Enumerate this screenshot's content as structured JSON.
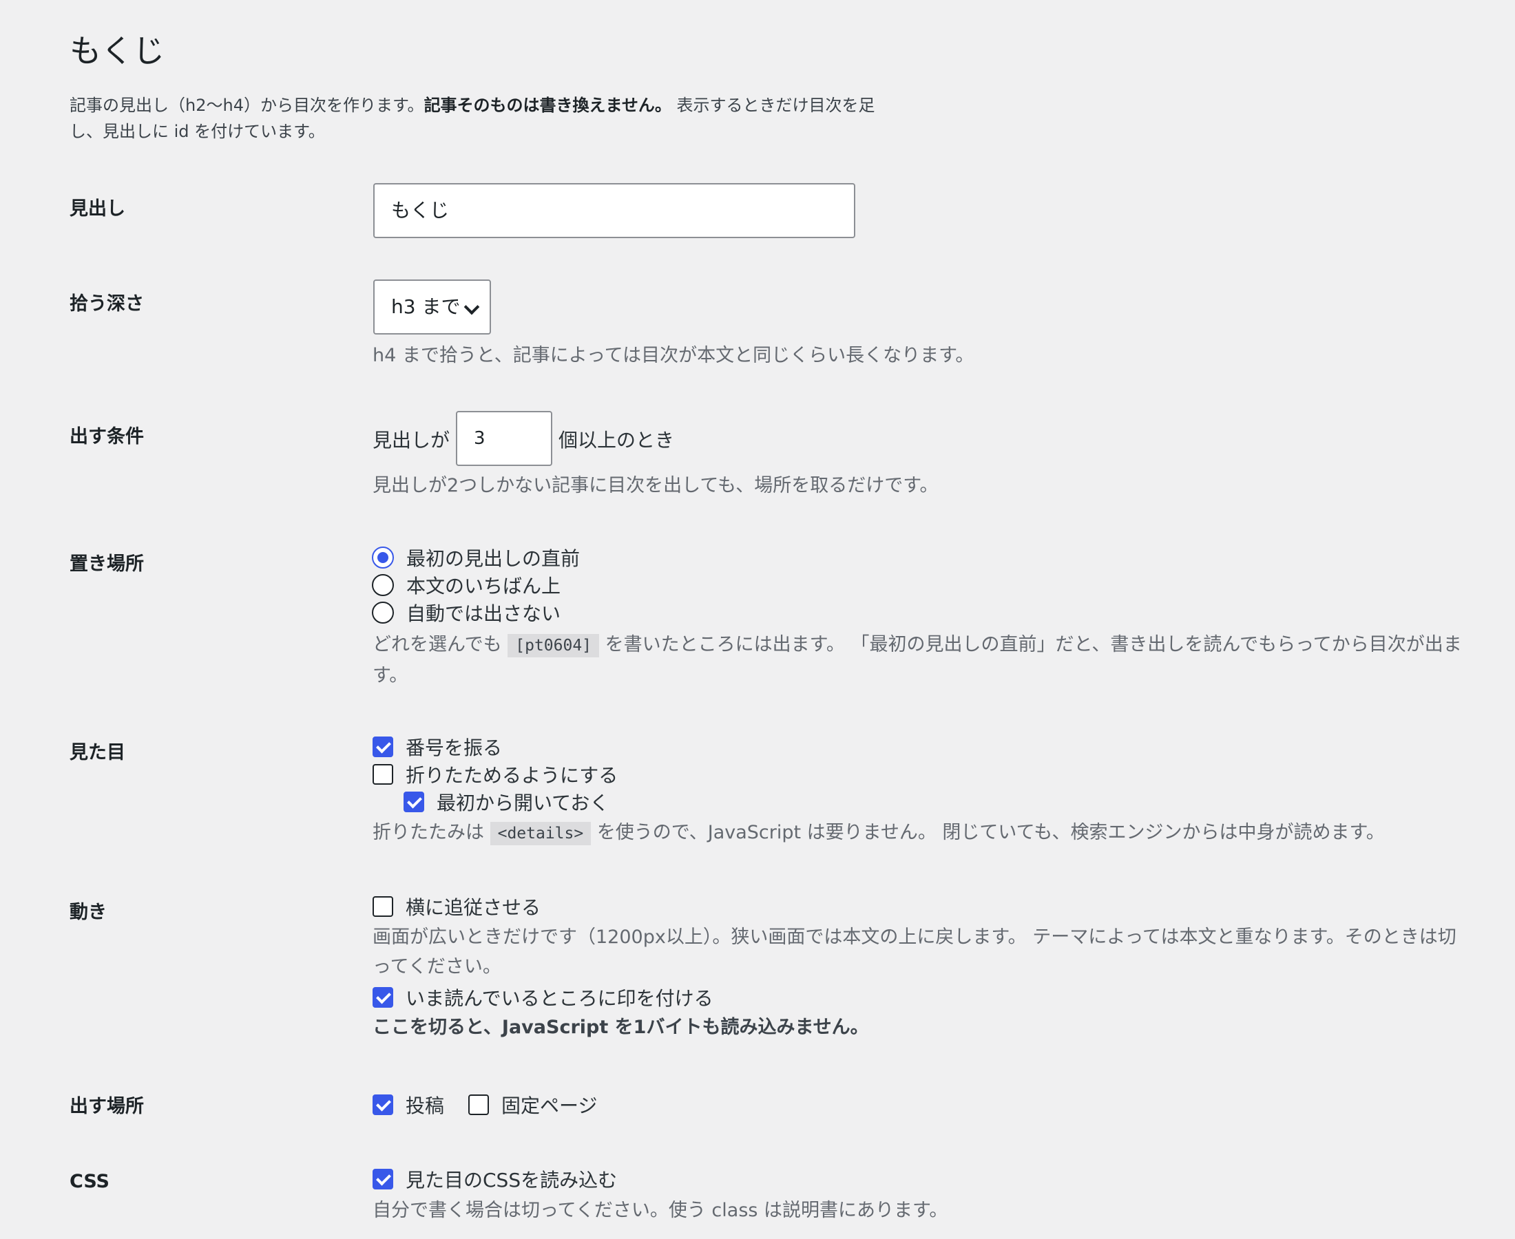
{
  "page": {
    "title": "もくじ"
  },
  "intro": {
    "text1": "記事の見出し（h2〜h4）から目次を作ります。",
    "bold": "記事そのものは書き換えません。",
    "text2": " 表示するときだけ目次を足し、見出しに id を付けています。"
  },
  "heading": {
    "label": "見出し",
    "value": "もくじ"
  },
  "depth": {
    "label": "拾う深さ",
    "selected": "h3 まで",
    "desc": "h4 まで拾うと、記事によっては目次が本文と同じくらい長くなります。"
  },
  "condition": {
    "label": "出す条件",
    "prefix": "見出しが",
    "value": "3",
    "suffix": "個以上のとき",
    "desc": "見出しが2つしかない記事に目次を出しても、場所を取るだけです。"
  },
  "placement": {
    "label": "置き場所",
    "options": [
      {
        "label": "最初の見出しの直前",
        "checked": true
      },
      {
        "label": "本文のいちばん上",
        "checked": false
      },
      {
        "label": "自動では出さない",
        "checked": false
      }
    ],
    "desc_before": "どれを選んでも",
    "desc_code": "[pt0604]",
    "desc_after": "を書いたところには出ます。 「最初の見出しの直前」だと、書き出しを読んでもらってから目次が出ます。"
  },
  "appearance": {
    "label": "見た目",
    "options": [
      {
        "label": "番号を振る",
        "checked": true
      },
      {
        "label": "折りたためるようにする",
        "checked": false
      },
      {
        "label": "最初から開いておく",
        "checked": true
      }
    ],
    "desc_before": "折りたたみは",
    "desc_code": "<details>",
    "desc_after": "を使うので、JavaScript は要りません。 閉じていても、検索エンジンからは中身が読めます。"
  },
  "motion": {
    "label": "動き",
    "follow": {
      "label": "横に追従させる",
      "checked": false
    },
    "follow_desc": "画面が広いときだけです（1200px以上）。狭い画面では本文の上に戻します。 テーマによっては本文と重なります。そのときは切ってください。",
    "highlight": {
      "label": "いま読んでいるところに印を付ける",
      "checked": true
    },
    "highlight_note": "ここを切ると、JavaScript を1バイトも読み込みません。"
  },
  "where": {
    "label": "出す場所",
    "options": [
      {
        "label": "投稿",
        "checked": true
      },
      {
        "label": "固定ページ",
        "checked": false
      }
    ]
  },
  "css": {
    "label": "CSS",
    "option": {
      "label": "見た目のCSSを読み込む",
      "checked": true
    },
    "desc": "自分で書く場合は切ってください。使う class は説明書にあります。"
  },
  "colors": {
    "accent": "#3858e9",
    "background": "#f0f0f1",
    "text": "#1d2327",
    "muted": "#646970"
  }
}
